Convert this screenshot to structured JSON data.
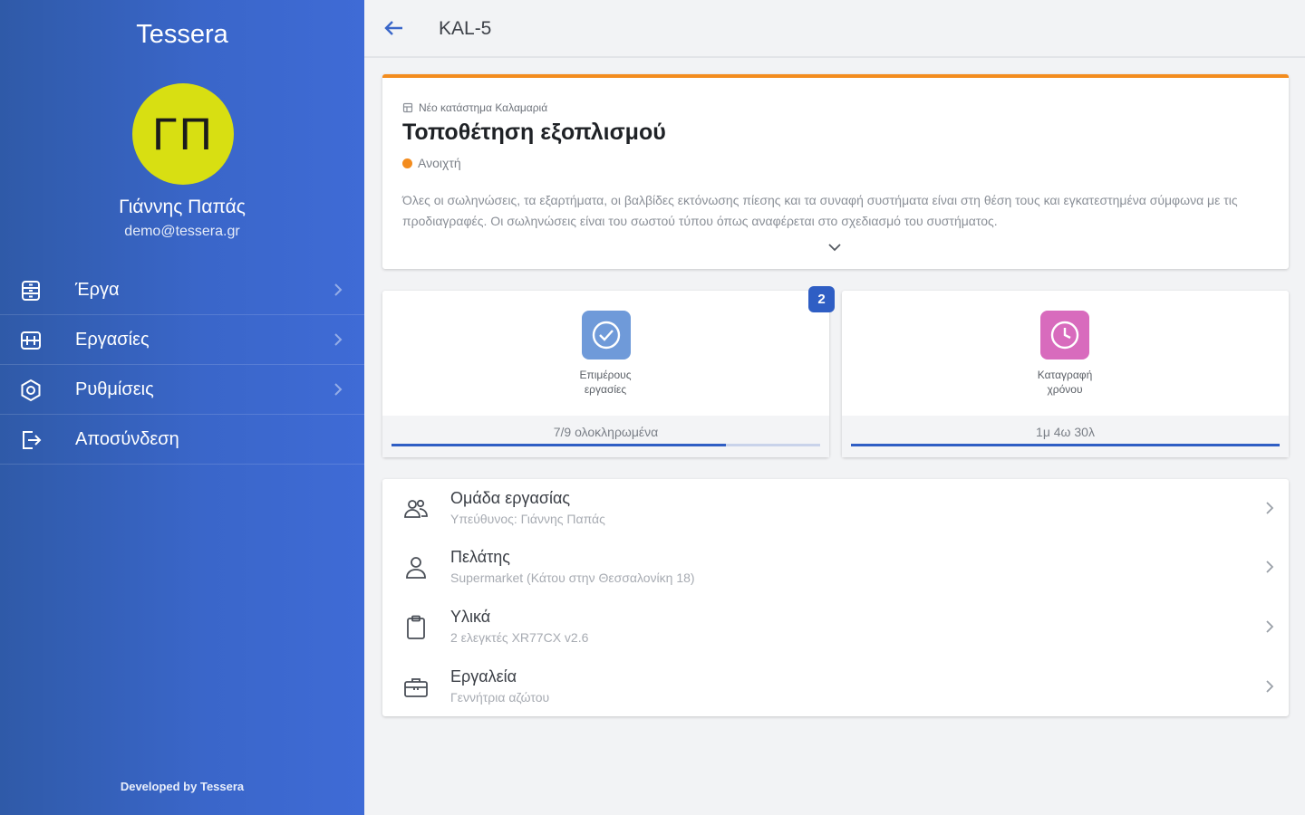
{
  "sidebar": {
    "brand": "Tessera",
    "avatar_initials": "ΓΠ",
    "user_name": "Γιάννης Παπάς",
    "user_email": "demo@tessera.gr",
    "items": [
      {
        "label": "Έργα",
        "icon": "projects-icon"
      },
      {
        "label": "Εργασίες",
        "icon": "tasks-icon"
      },
      {
        "label": "Ρυθμίσεις",
        "icon": "settings-icon"
      },
      {
        "label": "Αποσύνδεση",
        "icon": "logout-icon"
      }
    ],
    "footer": "Developed by Tessera"
  },
  "header": {
    "title": "KAL-5"
  },
  "task": {
    "store": "Νέο κατάστημα Καλαμαριά",
    "title": "Τοποθέτηση εξοπλισμού",
    "status": "Ανοιχτή",
    "description": "Όλες οι σωληνώσεις, τα εξαρτήματα, οι βαλβίδες εκτόνωσης πίεσης και τα συναφή συστήματα είναι στη θέση τους και εγκατεστημένα σύμφωνα με τις προδιαγραφές. Οι σωληνώσεις είναι του σωστού τύπου όπως αναφέρεται στο σχεδιασμό του συστήματος.",
    "accent_color": "#f38c1e"
  },
  "tiles": {
    "subtasks": {
      "label": "Επιμέρους εργασίες",
      "progress_text": "7/9 ολοκληρωμένα",
      "progress_fraction": 0.78,
      "badge": "2",
      "icon": "check-circle-icon",
      "color": "#6f9ad9"
    },
    "time": {
      "label": "Καταγραφή χρόνου",
      "progress_text": "1μ 4ω 30λ",
      "progress_fraction": 1.0,
      "icon": "clock-icon",
      "color": "#d86bbd"
    }
  },
  "info": [
    {
      "title": "Ομάδα εργασίας",
      "subtitle": "Υπεύθυνος: Γιάννης Παπάς",
      "icon": "team-icon"
    },
    {
      "title": "Πελάτης",
      "subtitle": "Supermarket (Κάτου στην Θεσσαλονίκη 18)",
      "icon": "person-icon"
    },
    {
      "title": "Υλικά",
      "subtitle": "2 ελεγκτές XR77CX v2.6",
      "icon": "clipboard-icon"
    },
    {
      "title": "Εργαλεία",
      "subtitle": "Γεννήτρια αζώτου",
      "icon": "toolbox-icon"
    }
  ]
}
